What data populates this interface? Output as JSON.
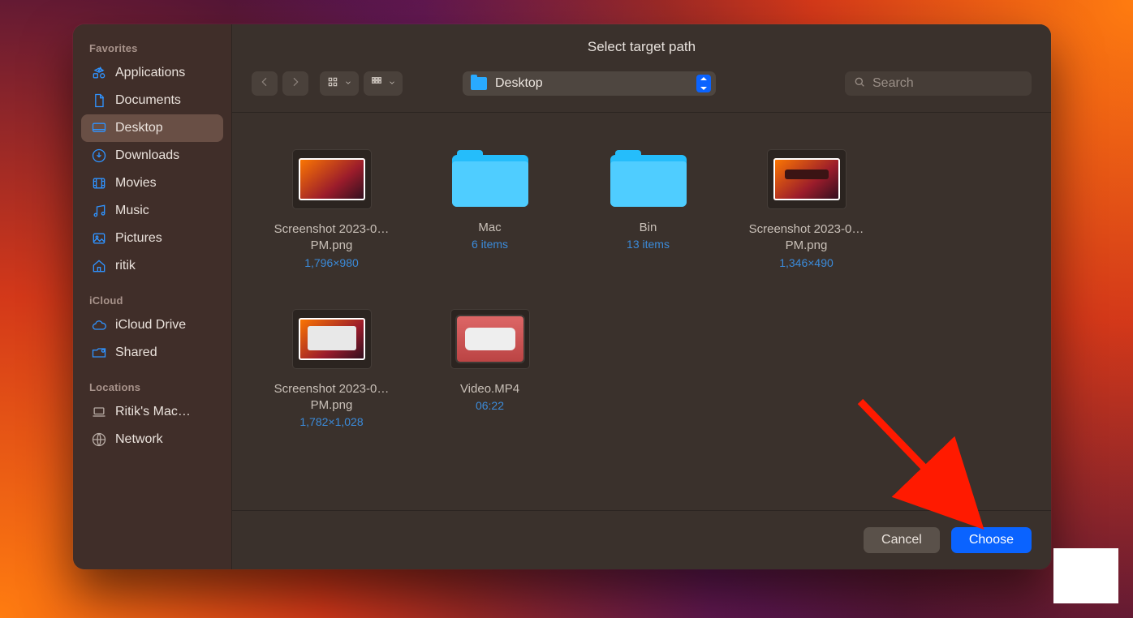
{
  "dialog": {
    "title": "Select target path",
    "location_label": "Desktop",
    "search_placeholder": "Search"
  },
  "sidebar": {
    "sections": [
      {
        "heading": "Favorites",
        "items": [
          {
            "id": "applications",
            "label": "Applications",
            "icon": "app-grid-icon"
          },
          {
            "id": "documents",
            "label": "Documents",
            "icon": "document-icon"
          },
          {
            "id": "desktop",
            "label": "Desktop",
            "icon": "desktop-icon",
            "active": true
          },
          {
            "id": "downloads",
            "label": "Downloads",
            "icon": "download-icon"
          },
          {
            "id": "movies",
            "label": "Movies",
            "icon": "film-icon"
          },
          {
            "id": "music",
            "label": "Music",
            "icon": "music-icon"
          },
          {
            "id": "pictures",
            "label": "Pictures",
            "icon": "image-icon"
          },
          {
            "id": "ritik",
            "label": "ritik",
            "icon": "home-icon"
          }
        ]
      },
      {
        "heading": "iCloud",
        "items": [
          {
            "id": "icloud-drive",
            "label": "iCloud Drive",
            "icon": "cloud-icon"
          },
          {
            "id": "shared",
            "label": "Shared",
            "icon": "shared-folder-icon"
          }
        ]
      },
      {
        "heading": "Locations",
        "items": [
          {
            "id": "ritiks-mac",
            "label": "Ritik's Mac…",
            "icon": "laptop-icon"
          },
          {
            "id": "network",
            "label": "Network",
            "icon": "globe-icon"
          }
        ]
      }
    ]
  },
  "files": [
    {
      "kind": "image",
      "name": "Screenshot 2023-0…PM.png",
      "meta": "1,796×980",
      "thumb": "screenshot"
    },
    {
      "kind": "folder",
      "name": "Mac",
      "meta": "6 items"
    },
    {
      "kind": "folder",
      "name": "Bin",
      "meta": "13 items"
    },
    {
      "kind": "image",
      "name": "Screenshot 2023-0…PM.png",
      "meta": "1,346×490",
      "thumb": "screenshot-dark"
    },
    {
      "kind": "image",
      "name": "Screenshot 2023-0…PM.png",
      "meta": "1,782×1,028",
      "thumb": "screenshot-light"
    },
    {
      "kind": "video",
      "name": "Video.MP4",
      "meta": "06:22"
    }
  ],
  "footer": {
    "cancel": "Cancel",
    "choose": "Choose"
  }
}
